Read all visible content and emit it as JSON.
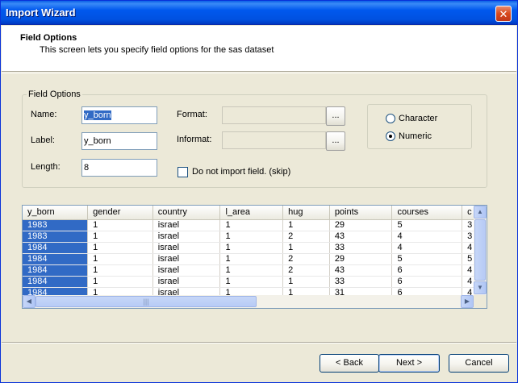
{
  "window": {
    "title": "Import Wizard",
    "close_glyph": "✕"
  },
  "header": {
    "heading": "Field Options",
    "description": "This screen lets you specify field options for the sas dataset"
  },
  "field_options": {
    "group_label": "Field Options",
    "name_label": "Name:",
    "name_value": "y_born",
    "label_label": "Label:",
    "label_value": "y_born",
    "length_label": "Length:",
    "length_value": "8",
    "format_label": "Format:",
    "format_value": "",
    "informat_label": "Informat:",
    "informat_value": "",
    "browse_label": "...",
    "skip_label": "Do not import field. (skip)",
    "skip_checked": false,
    "type_options": [
      {
        "label": "Character",
        "selected": false
      },
      {
        "label": "Numeric",
        "selected": true
      }
    ]
  },
  "grid": {
    "columns": [
      "y_born",
      "gender",
      "country",
      "l_area",
      "hug",
      "points",
      "courses",
      "c"
    ],
    "rows": [
      [
        "1983",
        "1",
        "israel",
        "1",
        "1",
        "29",
        "5",
        "3"
      ],
      [
        "1983",
        "1",
        "israel",
        "1",
        "2",
        "43",
        "4",
        "3"
      ],
      [
        "1984",
        "1",
        "israel",
        "1",
        "1",
        "33",
        "4",
        "4"
      ],
      [
        "1984",
        "1",
        "israel",
        "1",
        "2",
        "29",
        "5",
        "5"
      ],
      [
        "1984",
        "1",
        "israel",
        "1",
        "2",
        "43",
        "6",
        "4"
      ],
      [
        "1984",
        "1",
        "israel",
        "1",
        "1",
        "33",
        "6",
        "4"
      ],
      [
        "1984",
        "1",
        "israel",
        "1",
        "1",
        "31",
        "6",
        "4"
      ]
    ],
    "selected_column": 0,
    "scroll_up": "▲",
    "scroll_down": "▼",
    "scroll_left": "◀",
    "scroll_right": "▶",
    "grip": "|||"
  },
  "footer": {
    "back_label": "< Back",
    "next_label": "Next >",
    "cancel_label": "Cancel"
  }
}
